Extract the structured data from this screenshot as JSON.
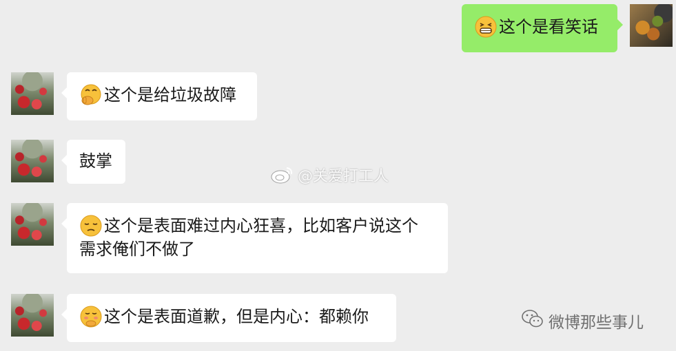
{
  "messages": [
    {
      "side": "right",
      "emoji": "grinning-squint-icon",
      "text": "这个是看笑话"
    },
    {
      "side": "left",
      "emoji": "hand-over-mouth-icon",
      "text": "这个是给垃圾故障"
    },
    {
      "side": "left",
      "emoji": "",
      "text": "鼓掌"
    },
    {
      "side": "left",
      "emoji": "pensive-face-icon",
      "line1": "这个是表面难过内心狂喜，比如客户说这个",
      "line2": "需求俺们不做了"
    },
    {
      "side": "left",
      "emoji": "embarrassed-face-icon",
      "text": "这个是表面道歉，但是内心：都赖你"
    }
  ],
  "watermark": {
    "text": "@关爱打工人"
  },
  "footer": {
    "text": "微博那些事儿"
  },
  "colors": {
    "bubble_self": "#95ec69",
    "bubble_other": "#ffffff",
    "background": "#ededed"
  }
}
